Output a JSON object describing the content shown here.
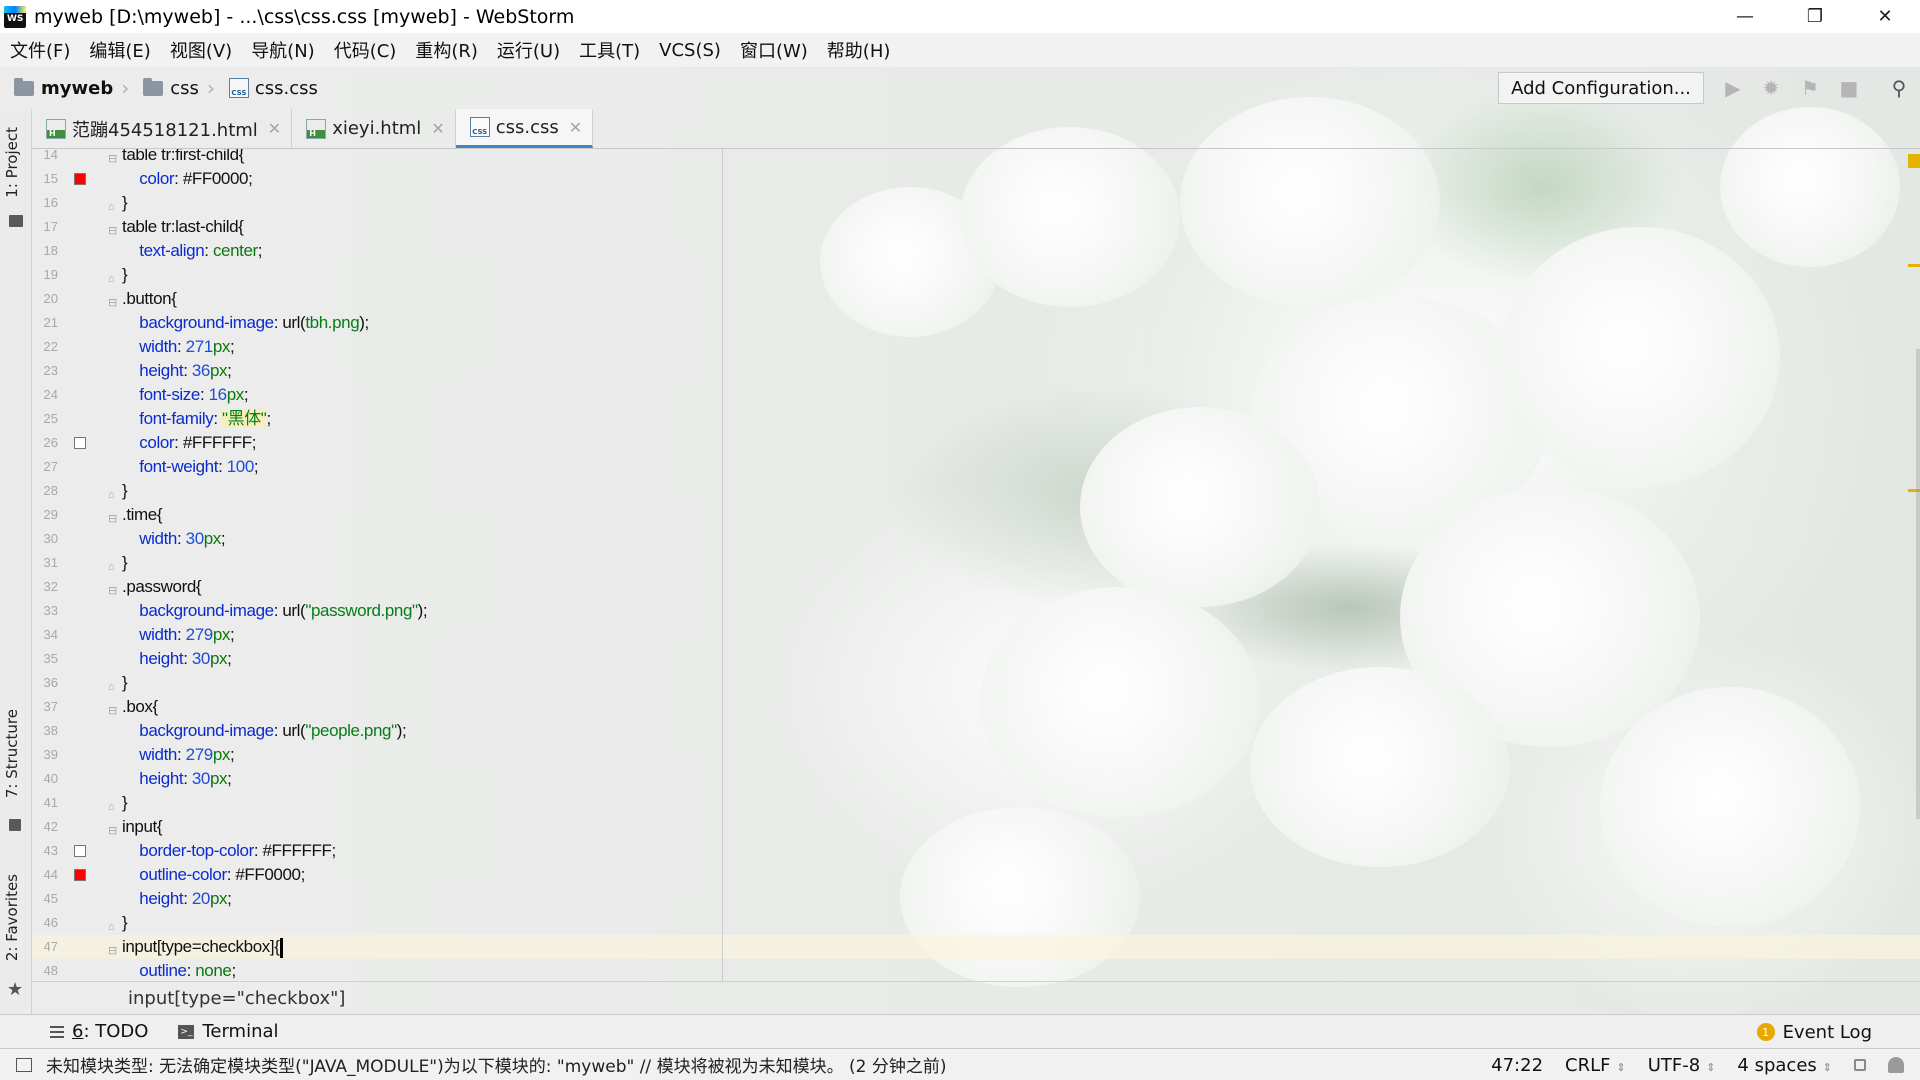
{
  "window": {
    "title": "myweb [D:\\myweb] - ...\\css\\css.css [myweb] - WebStorm",
    "app_icon_text": "WS",
    "controls": [
      "minimize",
      "restore",
      "close"
    ]
  },
  "menu": [
    "文件(F)",
    "编辑(E)",
    "视图(V)",
    "导航(N)",
    "代码(C)",
    "重构(R)",
    "运行(U)",
    "工具(T)",
    "VCS(S)",
    "窗口(W)",
    "帮助(H)"
  ],
  "navbar": {
    "breadcrumb": [
      "myweb",
      "css",
      "css.css"
    ],
    "add_configuration": "Add Configuration...",
    "icons": [
      "run-icon",
      "debug-icon",
      "coverage-icon",
      "stop-icon",
      "search-icon"
    ]
  },
  "tool_strip": {
    "project": "1: Project",
    "structure": "7: Structure",
    "favorites": "2: Favorites"
  },
  "tabs": [
    {
      "label": "范蹦454518121.html",
      "type": "html",
      "active": false
    },
    {
      "label": "xieyi.html",
      "type": "html",
      "active": false
    },
    {
      "label": "css.css",
      "type": "css",
      "active": true
    }
  ],
  "editor": {
    "lines": [
      {
        "n": "14",
        "text": "table tr:first-child{"
      },
      {
        "n": "15",
        "text": "    color: #FF0000;",
        "swatch": "#ff0000"
      },
      {
        "n": "16",
        "text": "}"
      },
      {
        "n": "17",
        "text": "table tr:last-child{"
      },
      {
        "n": "18",
        "text": "    text-align: center;"
      },
      {
        "n": "19",
        "text": "}"
      },
      {
        "n": "20",
        "text": ".button{"
      },
      {
        "n": "21",
        "text": "    background-image: url(tbh.png);"
      },
      {
        "n": "22",
        "text": "    width: 271px;"
      },
      {
        "n": "23",
        "text": "    height: 36px;"
      },
      {
        "n": "24",
        "text": "    font-size: 16px;"
      },
      {
        "n": "25",
        "text": "    font-family: \"黑体\";"
      },
      {
        "n": "26",
        "text": "    color: #FFFFFF;",
        "swatch": "#ffffff"
      },
      {
        "n": "27",
        "text": "    font-weight: 100;"
      },
      {
        "n": "28",
        "text": "}"
      },
      {
        "n": "29",
        "text": ".time{"
      },
      {
        "n": "30",
        "text": "    width: 30px;"
      },
      {
        "n": "31",
        "text": "}"
      },
      {
        "n": "32",
        "text": ".password{"
      },
      {
        "n": "33",
        "text": "    background-image: url(\"password.png\");"
      },
      {
        "n": "34",
        "text": "    width: 279px;"
      },
      {
        "n": "35",
        "text": "    height: 30px;"
      },
      {
        "n": "36",
        "text": "}"
      },
      {
        "n": "37",
        "text": ".box{"
      },
      {
        "n": "38",
        "text": "    background-image: url(\"people.png\");"
      },
      {
        "n": "39",
        "text": "    width: 279px;"
      },
      {
        "n": "40",
        "text": "    height: 30px;"
      },
      {
        "n": "41",
        "text": "}"
      },
      {
        "n": "42",
        "text": "input{"
      },
      {
        "n": "43",
        "text": "    border-top-color: #FFFFFF;",
        "swatch": "#ffffff"
      },
      {
        "n": "44",
        "text": "    outline-color: #FF0000;",
        "swatch": "#ff0000"
      },
      {
        "n": "45",
        "text": "    height: 20px;"
      },
      {
        "n": "46",
        "text": "}"
      },
      {
        "n": "47",
        "text": "input[type=checkbox]{",
        "current": true
      },
      {
        "n": "48",
        "text": "    outline: none;"
      }
    ],
    "breadcrumb": "input[type=\"checkbox\"]"
  },
  "bottom_tools": {
    "todo_number": "6",
    "todo_label": ": TODO",
    "terminal": "Terminal",
    "event_log": "Event Log",
    "event_count": "1"
  },
  "status": {
    "message": "未知模块类型: 无法确定模块类型(\"JAVA_MODULE\")为以下模块的: \"myweb\" // 模块将被视为未知模块。 (2 分钟之前)",
    "position": "47:22",
    "line_separator": "CRLF",
    "encoding": "UTF-8",
    "indent": "4 spaces"
  },
  "colors": {
    "accent": "#4083c9",
    "css_property": "#0a2bd0",
    "css_value": "#0a7a0a",
    "css_string": "#067d17",
    "warning": "#e6b400"
  }
}
